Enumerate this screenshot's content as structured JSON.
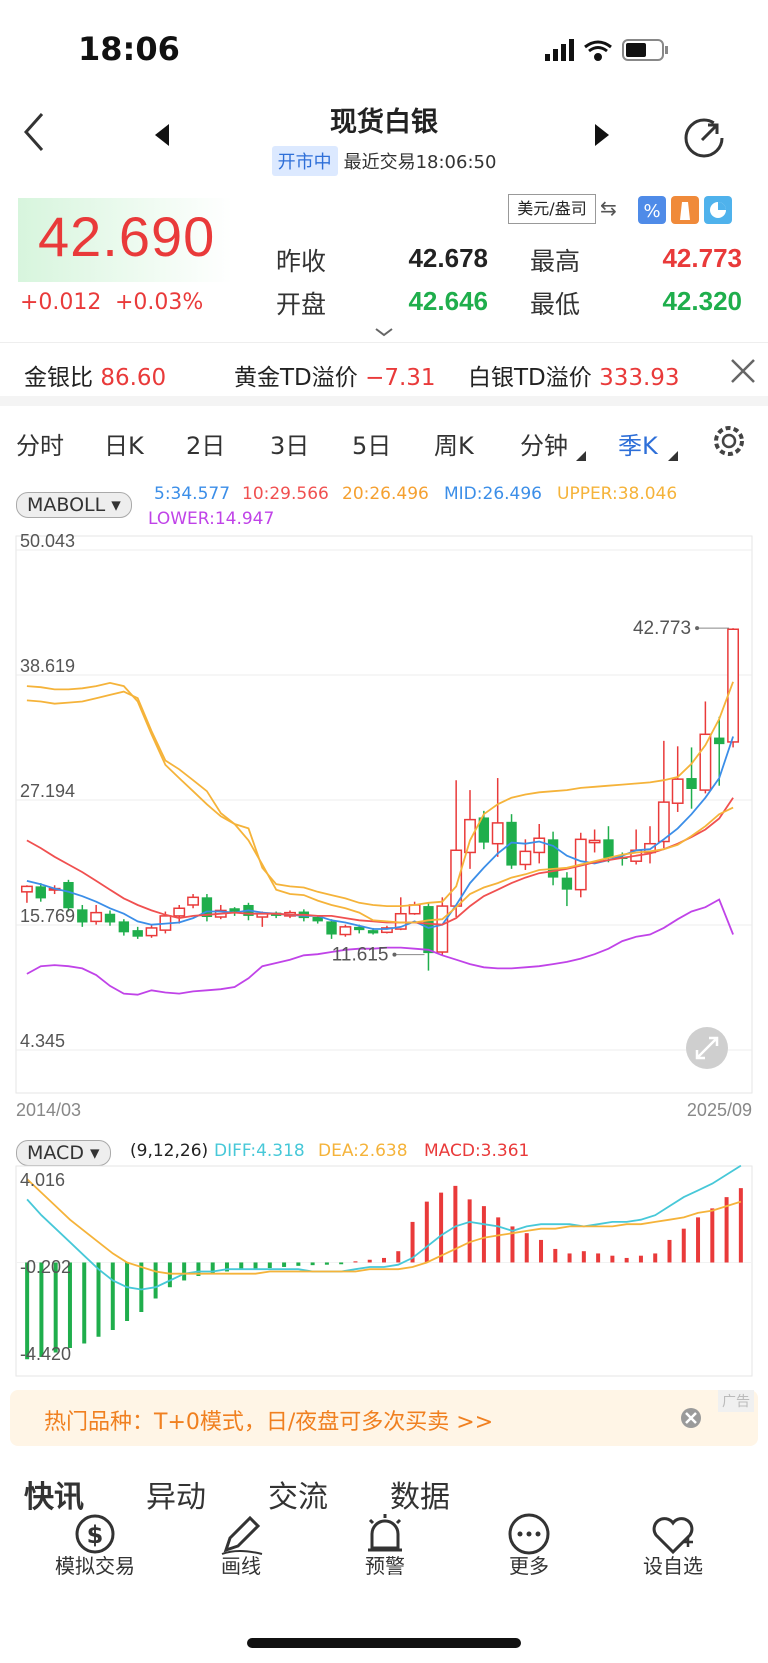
{
  "status": {
    "time": "18:06"
  },
  "header": {
    "title": "现货白银",
    "status_badge": "开市中",
    "last_trade": "最近交易18:06:50"
  },
  "quote": {
    "price": "42.690",
    "change": "+0.012",
    "change_pct": "+0.03%",
    "prev_close_label": "昨收",
    "prev_close": "42.678",
    "open_label": "开盘",
    "open": "42.646",
    "high_label": "最高",
    "high": "42.773",
    "low_label": "最低",
    "low": "42.320",
    "unit": "美元/盎司"
  },
  "ratios": {
    "gold_silver_label": "金银比",
    "gold_silver": "86.60",
    "gold_td_label": "黄金TD溢价",
    "gold_td": "−7.31",
    "silver_td_label": "白银TD溢价",
    "silver_td": "333.93"
  },
  "tabs": [
    "分时",
    "日K",
    "2日",
    "3日",
    "5日",
    "周K",
    "分钟",
    "季K"
  ],
  "active_tab": "季K",
  "indicator": {
    "name": "MABOLL",
    "ma5": "5:34.577",
    "ma10": "10:29.566",
    "ma20": "20:26.496",
    "mid": "MID:26.496",
    "upper": "UPPER:38.046",
    "lower": "LOWER:14.947"
  },
  "macd": {
    "name": "MACD",
    "params": "(9,12,26)",
    "diff": "DIFF:4.318",
    "dea": "DEA:2.638",
    "macd": "MACD:3.361"
  },
  "colors": {
    "up": "#e93a3a",
    "down": "#1fae4c",
    "ma5": "#3b8ee8",
    "ma10": "#f05050",
    "ma20": "#f5b33a",
    "boll": "#c043e8",
    "accent": "#2e6fd8"
  },
  "chart_data": [
    {
      "type": "candlestick",
      "y_ticks": [
        "50.043",
        "38.619",
        "27.194",
        "15.769",
        "4.345"
      ],
      "ylim": [
        4.345,
        50.043
      ],
      "x_start": "2014/03",
      "x_end": "2025/09",
      "max_label": "42.773",
      "min_label": "11.615",
      "candles": [
        [
          18.8,
          19.3,
          17.8,
          19.4
        ],
        [
          19.3,
          18.2,
          17.9,
          19.6
        ],
        [
          19.0,
          19.1,
          18.6,
          19.4
        ],
        [
          19.7,
          17.3,
          17.0,
          19.9
        ],
        [
          17.2,
          16.0,
          15.6,
          17.6
        ],
        [
          16.1,
          16.9,
          15.8,
          17.6
        ],
        [
          16.8,
          16.0,
          15.7,
          17.1
        ],
        [
          16.1,
          15.1,
          14.8,
          16.3
        ],
        [
          15.3,
          14.7,
          14.5,
          15.6
        ],
        [
          14.8,
          15.5,
          14.6,
          15.8
        ],
        [
          15.3,
          16.6,
          15.0,
          17.0
        ],
        [
          16.6,
          17.3,
          15.9,
          17.6
        ],
        [
          17.6,
          18.3,
          17.3,
          18.6
        ],
        [
          18.3,
          16.5,
          16.1,
          18.6
        ],
        [
          16.5,
          17.1,
          16.3,
          17.6
        ],
        [
          17.3,
          17.0,
          16.6,
          17.4
        ],
        [
          17.6,
          16.6,
          16.2,
          17.8
        ],
        [
          16.5,
          16.8,
          15.6,
          17.0
        ],
        [
          16.9,
          16.6,
          16.4,
          17.0
        ],
        [
          16.6,
          16.9,
          16.4,
          17.1
        ],
        [
          17.0,
          16.4,
          16.1,
          17.2
        ],
        [
          16.5,
          16.1,
          15.9,
          16.6
        ],
        [
          16.1,
          14.9,
          14.5,
          16.3
        ],
        [
          14.9,
          15.6,
          14.7,
          15.8
        ],
        [
          15.6,
          15.3,
          15.0,
          15.8
        ],
        [
          15.3,
          15.0,
          14.9,
          15.5
        ],
        [
          15.1,
          15.5,
          15.0,
          15.7
        ],
        [
          15.4,
          16.8,
          15.3,
          18.3
        ],
        [
          16.8,
          17.6,
          16.7,
          17.9
        ],
        [
          17.5,
          13.2,
          11.6,
          17.8
        ],
        [
          13.3,
          17.5,
          13.0,
          18.3
        ],
        [
          17.5,
          22.6,
          16.5,
          29.0
        ],
        [
          22.4,
          25.4,
          20.9,
          28.1
        ],
        [
          25.6,
          23.3,
          22.7,
          26.2
        ],
        [
          23.2,
          25.1,
          22.0,
          29.2
        ],
        [
          25.2,
          21.2,
          20.9,
          25.9
        ],
        [
          21.3,
          22.5,
          20.8,
          23.6
        ],
        [
          22.4,
          23.7,
          21.4,
          25.0
        ],
        [
          23.6,
          20.1,
          19.4,
          24.3
        ],
        [
          20.1,
          19.0,
          17.5,
          20.6
        ],
        [
          19.0,
          23.6,
          18.3,
          24.2
        ],
        [
          23.3,
          23.5,
          22.4,
          24.5
        ],
        [
          23.6,
          21.9,
          21.5,
          24.8
        ],
        [
          22.0,
          21.8,
          21.2,
          22.4
        ],
        [
          21.6,
          22.6,
          21.3,
          24.5
        ],
        [
          22.4,
          23.2,
          21.4,
          24.8
        ],
        [
          23.4,
          27.0,
          22.8,
          32.6
        ],
        [
          26.9,
          29.1,
          26.1,
          32.1
        ],
        [
          29.2,
          28.2,
          26.4,
          32.0
        ],
        [
          28.1,
          33.2,
          27.8,
          36.2
        ],
        [
          32.9,
          32.3,
          28.5,
          34.8
        ],
        [
          32.5,
          42.8,
          32.0,
          42.9
        ]
      ],
      "series": [
        {
          "name": "5",
          "values": [
            19.8,
            19.5,
            19.1,
            18.8,
            18.4,
            17.9,
            17.3,
            16.8,
            16.1,
            15.8,
            15.9,
            16.0,
            16.4,
            17.0,
            17.0,
            16.9,
            17.1,
            16.9,
            16.8,
            16.7,
            16.6,
            16.6,
            16.2,
            16.0,
            15.7,
            15.4,
            15.4,
            15.6,
            16.1,
            15.5,
            15.8,
            17.6,
            19.6,
            21.0,
            22.3,
            23.3,
            23.2,
            23.4,
            23.0,
            22.1,
            21.6,
            21.4,
            21.7,
            22.1,
            22.6,
            22.7,
            23.6,
            24.6,
            25.9,
            27.4,
            29.2,
            33.0
          ]
        },
        {
          "name": "10",
          "values": [
            23.5,
            22.8,
            22.0,
            21.3,
            20.6,
            19.8,
            19.0,
            18.2,
            17.6,
            17.1,
            16.7,
            16.4,
            16.6,
            16.7,
            16.8,
            16.9,
            16.8,
            16.8,
            16.8,
            16.7,
            16.7,
            16.6,
            16.6,
            16.4,
            16.2,
            16.1,
            16.0,
            16.0,
            16.0,
            15.9,
            15.8,
            16.4,
            17.5,
            18.4,
            19.0,
            19.6,
            20.1,
            20.5,
            20.7,
            20.9,
            21.2,
            21.5,
            21.7,
            21.9,
            22.1,
            22.3,
            22.7,
            23.2,
            23.8,
            24.5,
            25.5,
            27.4
          ]
        },
        {
          "name": "20",
          "values": [
            36.3,
            36.2,
            36.0,
            36.1,
            36.2,
            36.5,
            36.8,
            37.1,
            36.5,
            33.5,
            30.8,
            30.0,
            29.0,
            28.0,
            26.0,
            25.0,
            23.5,
            21.3,
            19.0,
            18.6,
            18.5,
            18.0,
            17.6,
            17.3,
            16.9,
            16.2,
            16.1,
            16.0,
            16.0,
            16.2,
            16.3,
            17.4,
            18.6,
            19.2,
            19.6,
            20.1,
            20.4,
            20.8,
            20.9,
            21.0,
            21.3,
            21.6,
            21.9,
            22.2,
            22.4,
            22.5,
            22.7,
            23.1,
            23.9,
            24.8,
            25.9,
            26.5
          ]
        },
        {
          "name": "UPPER",
          "values": [
            37.6,
            37.5,
            37.3,
            37.3,
            37.4,
            37.6,
            37.9,
            37.6,
            36.2,
            33.2,
            30.4,
            29.2,
            28.0,
            26.8,
            25.7,
            25.0,
            24.6,
            21.0,
            19.5,
            19.3,
            19.2,
            18.8,
            18.5,
            18.2,
            17.8,
            17.6,
            17.5,
            17.5,
            17.6,
            17.8,
            17.9,
            19.3,
            23.5,
            25.9,
            26.8,
            27.4,
            27.7,
            27.9,
            28.0,
            28.1,
            28.3,
            28.4,
            28.5,
            28.6,
            28.7,
            28.8,
            29.0,
            29.3,
            30.5,
            32.2,
            34.6,
            38.0
          ]
        },
        {
          "name": "LOWER",
          "values": [
            11.3,
            12.0,
            12.1,
            12.0,
            11.8,
            11.2,
            10.2,
            9.5,
            9.4,
            9.8,
            9.6,
            9.5,
            9.7,
            9.8,
            9.9,
            10.1,
            10.9,
            12.0,
            12.3,
            12.6,
            13.0,
            13.1,
            13.3,
            13.5,
            13.6,
            13.6,
            13.7,
            13.7,
            13.6,
            13.5,
            13.0,
            12.6,
            12.2,
            11.9,
            11.8,
            11.8,
            11.9,
            12.0,
            12.2,
            12.4,
            12.7,
            13.1,
            13.6,
            14.3,
            14.7,
            14.9,
            15.5,
            16.3,
            17.0,
            17.4,
            18.1,
            14.9
          ]
        }
      ]
    },
    {
      "type": "bar+line",
      "y_ticks": [
        "4.016",
        "-0.202",
        "-4.420"
      ],
      "ylim": [
        -4.42,
        4.016
      ],
      "hist": [
        -4.3,
        -4.2,
        -4.0,
        -3.8,
        -3.6,
        -3.3,
        -3.0,
        -2.6,
        -2.2,
        -1.6,
        -1.1,
        -0.8,
        -0.6,
        -0.5,
        -0.4,
        -0.3,
        -0.3,
        -0.25,
        -0.2,
        -0.15,
        -0.12,
        -0.1,
        -0.08,
        0.05,
        0.12,
        0.2,
        0.5,
        1.8,
        2.7,
        3.1,
        3.4,
        2.8,
        2.5,
        2.0,
        1.6,
        1.3,
        1.0,
        0.6,
        0.4,
        0.5,
        0.4,
        0.3,
        0.2,
        0.3,
        0.4,
        1.0,
        1.5,
        2.0,
        2.4,
        2.9,
        3.3
      ],
      "series": [
        {
          "name": "DIFF",
          "values": [
            2.8,
            2.1,
            1.5,
            0.9,
            0.3,
            -0.3,
            -0.8,
            -1.1,
            -1.2,
            -1.1,
            -0.8,
            -0.5,
            -0.4,
            -0.4,
            -0.3,
            -0.3,
            -0.3,
            -0.3,
            -0.3,
            -0.3,
            -0.4,
            -0.4,
            -0.4,
            -0.3,
            -0.2,
            -0.2,
            -0.1,
            0.2,
            0.7,
            1.2,
            1.6,
            1.8,
            1.7,
            1.6,
            1.4,
            1.6,
            1.7,
            1.7,
            1.7,
            1.6,
            1.7,
            1.8,
            1.8,
            1.9,
            2.1,
            2.5,
            2.9,
            3.2,
            3.5,
            3.9,
            4.3
          ]
        },
        {
          "name": "DEA",
          "values": [
            3.7,
            3.1,
            2.5,
            1.9,
            1.4,
            0.9,
            0.4,
            0.0,
            -0.2,
            -0.4,
            -0.5,
            -0.5,
            -0.5,
            -0.5,
            -0.5,
            -0.5,
            -0.5,
            -0.4,
            -0.4,
            -0.4,
            -0.4,
            -0.4,
            -0.4,
            -0.4,
            -0.3,
            -0.3,
            -0.3,
            -0.2,
            0.0,
            0.3,
            0.6,
            0.9,
            1.1,
            1.2,
            1.3,
            1.4,
            1.5,
            1.5,
            1.6,
            1.6,
            1.6,
            1.6,
            1.7,
            1.7,
            1.8,
            1.9,
            2.0,
            2.2,
            2.3,
            2.5,
            2.7
          ]
        }
      ]
    }
  ],
  "ad": {
    "text": "热门品种：T+0模式，日/夜盘可多次买卖 >>",
    "tag": "广告"
  },
  "news_tabs": [
    "快讯",
    "异动",
    "交流",
    "数据"
  ],
  "bottom_bar": [
    {
      "label": "模拟交易",
      "icon": "dollar-cycle-icon"
    },
    {
      "label": "画线",
      "icon": "pen-icon"
    },
    {
      "label": "预警",
      "icon": "alarm-icon"
    },
    {
      "label": "更多",
      "icon": "more-icon"
    },
    {
      "label": "设自选",
      "icon": "heart-plus-icon"
    }
  ]
}
